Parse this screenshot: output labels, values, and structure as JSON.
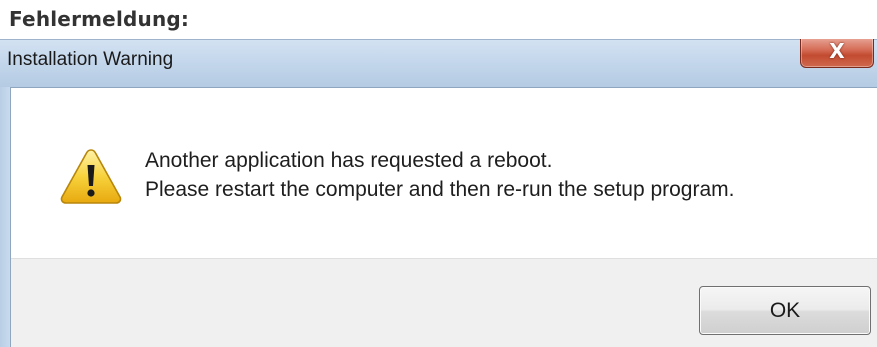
{
  "heading": "Fehlermeldung:",
  "dialog": {
    "title": "Installation Warning",
    "close_glyph": "X",
    "icon": "warning-icon",
    "message_lines": [
      "Another application has requested a reboot.",
      "Please restart the computer and then re-run the setup program."
    ],
    "ok_label": "OK"
  },
  "colors": {
    "titlebar": "#c4d7ec",
    "close_button": "#c24b30",
    "footer": "#f0f0f0",
    "warning_fill": "#f4c430"
  }
}
